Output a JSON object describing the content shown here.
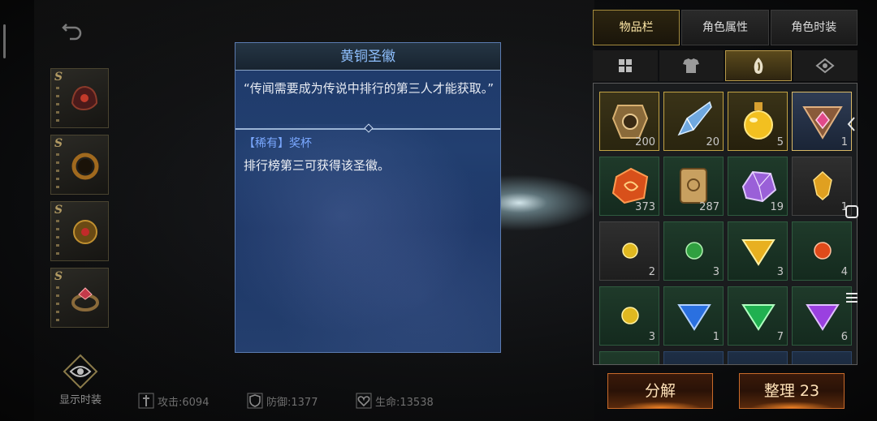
{
  "tooltip": {
    "title": "黄铜圣徽",
    "quote": "“传闻需要成为传说中排行的第三人才能获取。”",
    "rarity": "【稀有】奖杯",
    "description": "排行榜第三可获得该圣徽。"
  },
  "character": {
    "equip_slots": [
      {
        "grade": "S",
        "icon": "dragon-helm-icon"
      },
      {
        "grade": "S",
        "icon": "ring-icon"
      },
      {
        "grade": "S",
        "icon": "orb-icon"
      },
      {
        "grade": "S",
        "icon": "gem-ring-icon"
      }
    ],
    "show_fashion_label": "显示时装",
    "stats": {
      "attack": "攻击:6094",
      "defense": "防御:1377",
      "hp": "生命:13538"
    }
  },
  "tabs": {
    "items": [
      {
        "label": "物品栏",
        "active": true
      },
      {
        "label": "角色属性",
        "active": false
      },
      {
        "label": "角色时装",
        "active": false
      }
    ]
  },
  "subtabs": [
    {
      "icon": "grid-icon",
      "active": false
    },
    {
      "icon": "armor-icon",
      "active": false
    },
    {
      "icon": "material-icon",
      "active": true
    },
    {
      "icon": "misc-icon",
      "active": false
    }
  ],
  "inventory": {
    "items": [
      {
        "name": "crest-icon",
        "qty": "200",
        "frame": "gold"
      },
      {
        "name": "crystal-shard-icon",
        "qty": "20",
        "frame": "gold"
      },
      {
        "name": "potion-icon",
        "qty": "5",
        "frame": "gold2"
      },
      {
        "name": "brass-emblem-icon",
        "qty": "1",
        "frame": "sel"
      },
      {
        "name": "rune-stone-icon",
        "qty": "373",
        "frame": "green"
      },
      {
        "name": "scroll-icon",
        "qty": "287",
        "frame": "green"
      },
      {
        "name": "amethyst-icon",
        "qty": "19",
        "frame": "green"
      },
      {
        "name": "topaz-icon",
        "qty": "1",
        "frame": "gray"
      },
      {
        "name": "yellow-orb-icon",
        "qty": "2",
        "frame": "gray"
      },
      {
        "name": "green-orb-icon",
        "qty": "3",
        "frame": "green"
      },
      {
        "name": "yellow-triangle-gem-icon",
        "qty": "3",
        "frame": "green"
      },
      {
        "name": "red-orb-icon",
        "qty": "4",
        "frame": "green"
      },
      {
        "name": "yellow-orb-icon",
        "qty": "3",
        "frame": "green"
      },
      {
        "name": "blue-triangle-gem-icon",
        "qty": "1",
        "frame": "green"
      },
      {
        "name": "green-triangle-gem-icon",
        "qty": "7",
        "frame": "green"
      },
      {
        "name": "purple-triangle-gem-icon",
        "qty": "6",
        "frame": "green"
      }
    ]
  },
  "buttons": {
    "decompose": "分解",
    "organize": "整理 23"
  },
  "colors": {
    "accent_gold": "#c2a344",
    "tooltip_bg": "#1f3a6a",
    "tooltip_title": "#8fc0ff",
    "rarity_text": "#7aa8ff",
    "button_orange": "#c86a2a"
  }
}
